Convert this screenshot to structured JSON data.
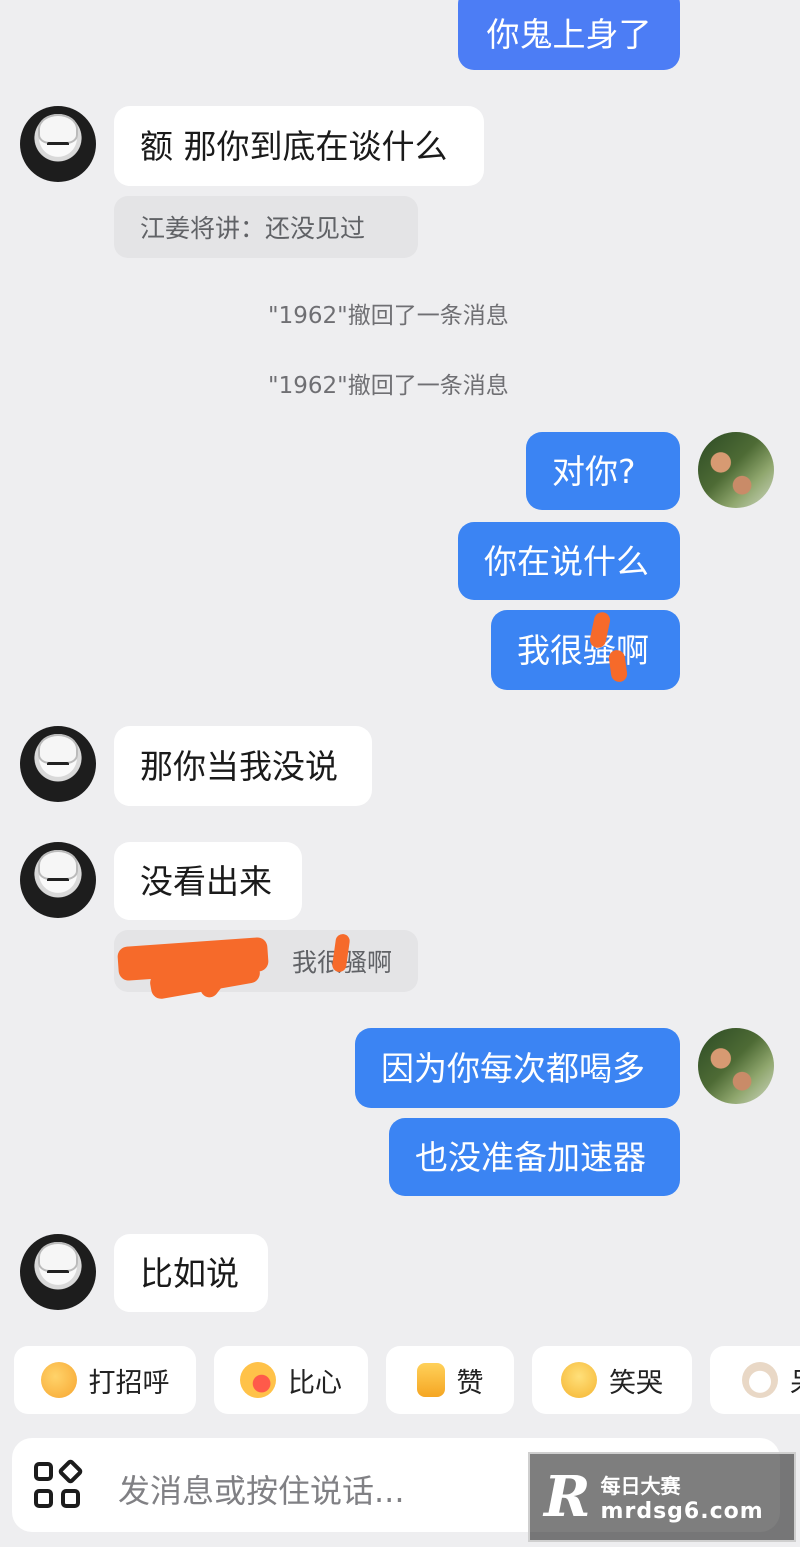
{
  "messages": {
    "m1": "你鬼上身了",
    "m2": "额 那你到底在谈什么",
    "m2_quote": "江姜将讲：还没见过",
    "sys1": "\"1962\"撤回了一条消息",
    "sys2": "\"1962\"撤回了一条消息",
    "m3": "对你?",
    "m4": "你在说什么",
    "m5": "我很骚啊",
    "m6": "那你当我没说",
    "m7": "没看出来",
    "m7_quote": "我很骚啊",
    "m8": "因为你每次都喝多",
    "m9": "也没准备加速器",
    "m10": "比如说"
  },
  "quick_replies": [
    {
      "label": "打招呼",
      "icon": "wave-emoji-icon",
      "color": "#f7a631"
    },
    {
      "label": "比心",
      "icon": "heart-hand-emoji-icon",
      "color": "#f59a2a"
    },
    {
      "label": "赞",
      "icon": "thumbs-up-icon",
      "color": "#f8b83c"
    },
    {
      "label": "笑哭",
      "icon": "laugh-cry-emoji-icon",
      "color": "#f5b532"
    },
    {
      "label": "呆",
      "icon": "cat-face-icon",
      "color": "#e9d8c6"
    }
  ],
  "input": {
    "placeholder": "发消息或按住说话..."
  },
  "watermark": {
    "logo": "R",
    "line1": "每日大赛",
    "line2": "mrdsg6.com"
  },
  "colors": {
    "background": "#eeeef0",
    "outgoing_bubble": "#3b84f3",
    "incoming_bubble": "#ffffff",
    "redaction": "#f66a2a"
  }
}
